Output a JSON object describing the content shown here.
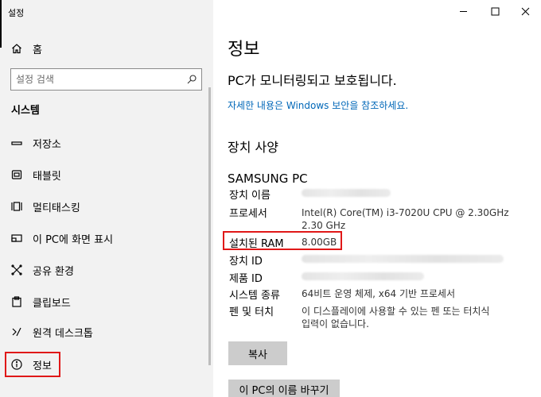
{
  "window": {
    "title": "설정",
    "controls": {
      "minimize_icon": "minimize-icon",
      "maximize_icon": "maximize-icon",
      "close_icon": "close-icon"
    }
  },
  "sidebar": {
    "home_label": "홈",
    "search_placeholder": "설정 검색",
    "section_title": "시스템",
    "items": [
      {
        "label": "저장소",
        "icon": "storage-icon"
      },
      {
        "label": "태블릿",
        "icon": "tablet-icon"
      },
      {
        "label": "멀티태스킹",
        "icon": "multitasking-icon"
      },
      {
        "label": "이 PC에 화면 표시",
        "icon": "project-icon"
      },
      {
        "label": "공유 환경",
        "icon": "shared-experiences-icon"
      },
      {
        "label": "클립보드",
        "icon": "clipboard-icon"
      },
      {
        "label": "원격 데스크톱",
        "icon": "remote-desktop-icon"
      },
      {
        "label": "정보",
        "icon": "info-icon",
        "selected": true
      }
    ]
  },
  "main": {
    "title": "정보",
    "protection_status": "PC가 모니터링되고 보호됩니다.",
    "security_link": "자세한 내용은 Windows 보안을 참조하세요.",
    "device_specs_heading": "장치 사양",
    "device_name": "SAMSUNG PC",
    "specs": {
      "device_name_label": "장치 이름",
      "processor_label": "프로세서",
      "processor_value_line1": "Intel(R) Core(TM) i3-7020U CPU @ 2.30GHz",
      "processor_value_line2": "2.30 GHz",
      "ram_label": "설치된 RAM",
      "ram_value": "8.00GB",
      "device_id_label": "장치 ID",
      "product_id_label": "제품 ID",
      "system_type_label": "시스템 종류",
      "system_type_value": "64비트 운영 체제, x64 기반 프로세서",
      "pen_touch_label": "펜 및 터치",
      "pen_touch_value_line1": "이 디스플레이에 사용할 수 있는 펜 또는 터치식",
      "pen_touch_value_line2": "입력이 없습니다."
    },
    "copy_button": "복사",
    "rename_button": "이 PC의 이름 바꾸기"
  }
}
